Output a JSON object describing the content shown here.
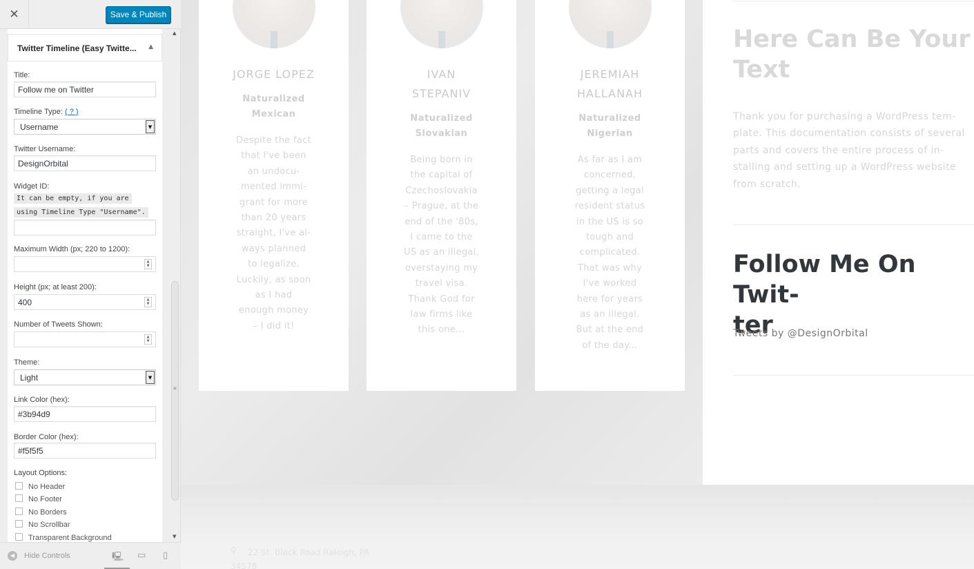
{
  "topbar": {
    "close_glyph": "✕",
    "save_label": "Save & Publish"
  },
  "widget": {
    "title": "Twitter Timeline (Easy Twitte...",
    "arrow": "▲",
    "fields": {
      "title_label": "Title:",
      "title_value": "Follow me on Twitter",
      "timeline_type_label": "Timeline Type:",
      "timeline_type_help": "( ? )",
      "timeline_type_value": "Username",
      "username_label": "Twitter Username:",
      "username_value": "DesignOrbital",
      "widget_id_label": "Widget ID:",
      "widget_id_note_1": "It can be empty, if you are",
      "widget_id_note_2": "using Timeline Type \"Username\".",
      "widget_id_value": "",
      "max_width_label": "Maximum Width (px; 220 to 1200):",
      "max_width_value": "",
      "height_label": "Height (px; at least 200):",
      "height_value": "400",
      "tweets_label": "Number of Tweets Shown:",
      "tweets_value": "",
      "theme_label": "Theme:",
      "theme_value": "Light",
      "link_color_label": "Link Color (hex):",
      "link_color_value": "#3b94d9",
      "border_color_label": "Border Color (hex):",
      "border_color_value": "#f5f5f5",
      "layout_label": "Layout Options:",
      "layout_options": [
        "No Header",
        "No Footer",
        "No Borders",
        "No Scrollbar",
        "Transparent Background"
      ]
    }
  },
  "footer": {
    "hide_label": "Hide Controls",
    "hide_icon": "◀",
    "desktop_icon": "🖳",
    "tablet_icon": "▭",
    "mobile_icon": "▯"
  },
  "scrollbar": {
    "up": "▲",
    "down": "▼",
    "grip": "≡"
  },
  "preview": {
    "cards": [
      {
        "name": "JORGE LOPEZ",
        "nationality_1": "Naturalized",
        "nationality_2": "Mexican",
        "bio": [
          "Despite the fact",
          "that I've been",
          "an undocu-",
          "mented immi-",
          "grant for more",
          "than 20 years",
          "straight, I've al-",
          "ways planned",
          "to legalize.",
          "Luckily, as soon",
          "as I had",
          "enough money",
          "– I did it!"
        ]
      },
      {
        "name_1": "IVAN",
        "name_2": "STEPANIV",
        "nationality_1": "Naturalized",
        "nationality_2": "Slovakian",
        "bio": [
          "Being born in",
          "the capital of",
          "Czechoslovakia",
          "– Prague, at the",
          "end of the '80s,",
          "I came to the",
          "US as an illegal,",
          "overstaying my",
          "travel visa.",
          "Thank God for",
          "law firms like",
          "this one..."
        ]
      },
      {
        "name_1": "JEREMIAH",
        "name_2": "HALLANAH",
        "nationality_1": "Naturalized",
        "nationality_2": "Nigerian",
        "bio": [
          "As far as I am",
          "concerned,",
          "getting a legal",
          "resident status",
          "in the US is so",
          "tough and",
          "complicated.",
          "That was why",
          "I've worked",
          "here for years",
          "as an illegal.",
          "But at the end",
          "of the day..."
        ]
      }
    ],
    "right": {
      "heading_1": "Here Can Be Your",
      "heading_2": "Text",
      "paragraph": [
        "Thank you for purchasing a WordPress tem-",
        "plate. This documentation consists of several",
        "parts and covers the entire process of in-",
        "stalling and setting up a WordPress website",
        "from scratch."
      ],
      "twitter_heading_1": "Follow Me On Twit-",
      "twitter_heading_2": "ter",
      "tweets_by": "Tweets by @DesignOrbital"
    },
    "footer_icon": "⚲",
    "address": "22 St. Black Road Raleigh, PA 34578"
  }
}
